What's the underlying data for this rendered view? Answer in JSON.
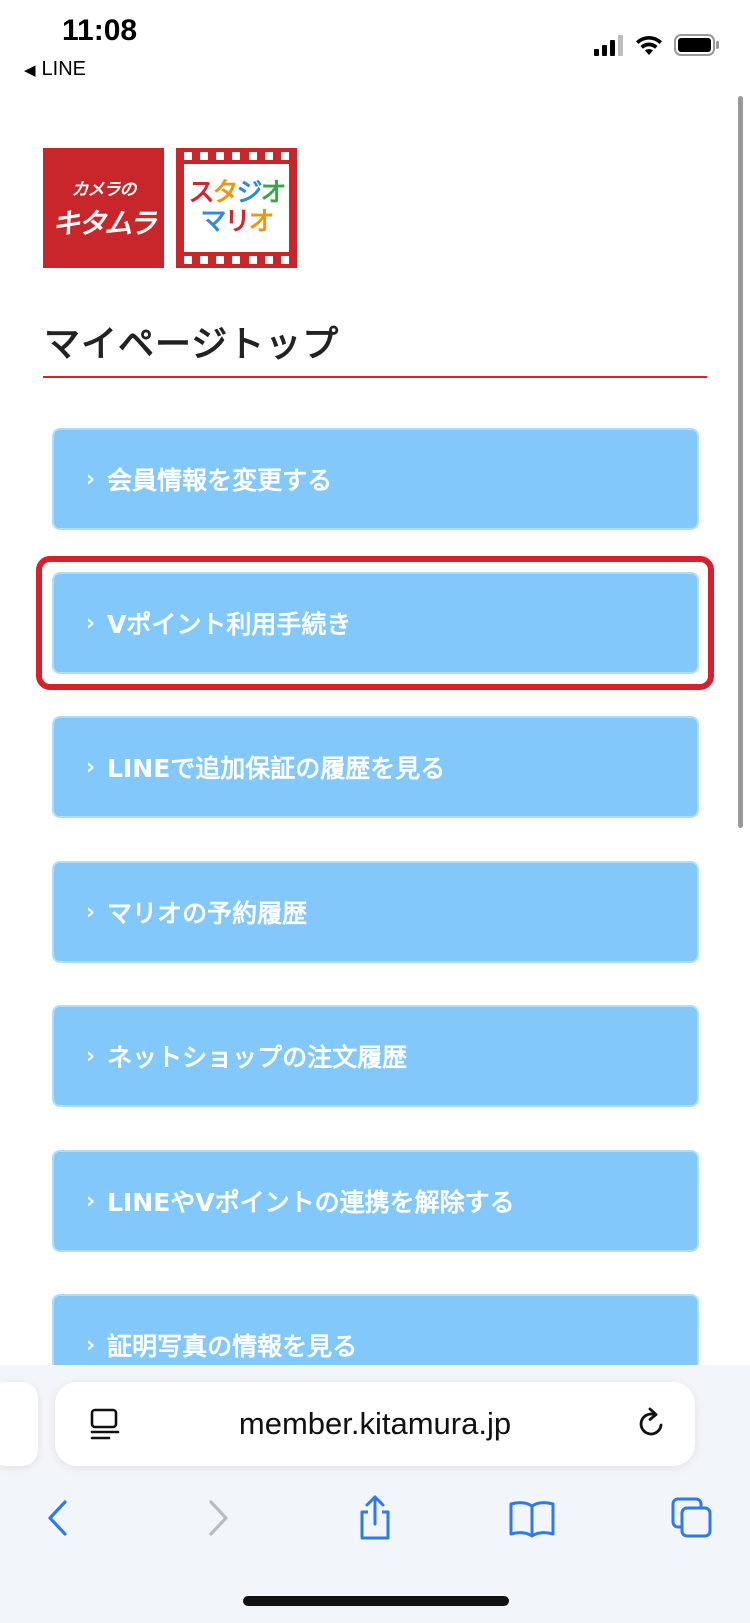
{
  "status_bar": {
    "time": "11:08",
    "back_app": "LINE",
    "back_icon": "back-triangle-icon",
    "icons": [
      "cellular-signal-icon",
      "wifi-icon",
      "battery-icon"
    ]
  },
  "logos": {
    "kitamura": {
      "line1": "カメラの",
      "line2": "キタムラ"
    },
    "mario": {
      "line1": "スタジオ",
      "line2": "マリオ"
    }
  },
  "page": {
    "title": "マイページトップ"
  },
  "menu": {
    "chevron": "›",
    "items": [
      {
        "label": "会員情報を変更する"
      },
      {
        "label": "Vポイント利用手続き"
      },
      {
        "label": "LINEで追加保証の履歴を見る"
      },
      {
        "label": "マリオの予約履歴"
      },
      {
        "label": "ネットショップの注文履歴"
      },
      {
        "label": "LINEやVポイントの連携を解除する"
      },
      {
        "label": "証明写真の情報を見る"
      }
    ]
  },
  "browser": {
    "url": "member.kitamura.jp",
    "reader_icon": "page-menu-icon",
    "reload_icon": "reload-icon",
    "toolbar_icons": [
      "back-icon",
      "forward-icon",
      "share-icon",
      "bookmarks-icon",
      "tabs-icon"
    ]
  },
  "colors": {
    "accent_red": "#d6242b",
    "button_blue": "#82c8fa",
    "ios_blue": "#2f7ae5"
  }
}
